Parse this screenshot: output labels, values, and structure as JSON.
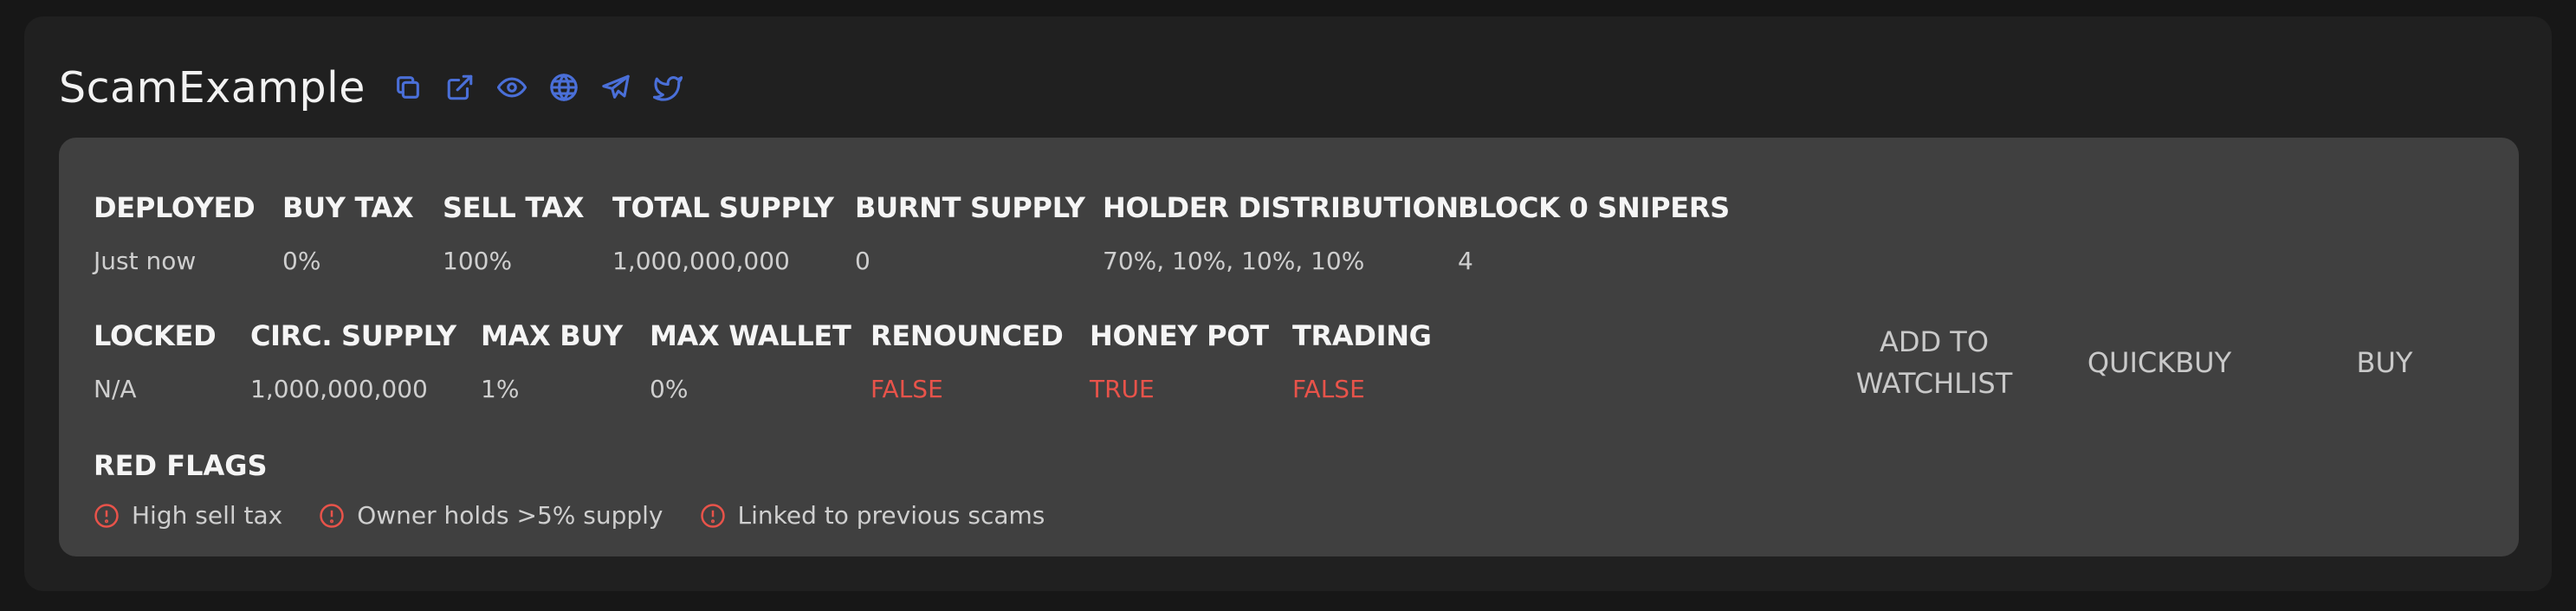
{
  "header": {
    "title": "ScamExample",
    "icons": [
      "copy-icon",
      "external-link-icon",
      "eye-icon",
      "globe-icon",
      "telegram-icon",
      "twitter-icon"
    ]
  },
  "row1": [
    {
      "label": "DEPLOYED",
      "value": "Just now"
    },
    {
      "label": "BUY TAX",
      "value": "0%"
    },
    {
      "label": "SELL TAX",
      "value": "100%"
    },
    {
      "label": "TOTAL SUPPLY",
      "value": "1,000,000,000"
    },
    {
      "label": "BURNT SUPPLY",
      "value": "0"
    },
    {
      "label": "HOLDER DISTRIBUTION",
      "value": "70%, 10%, 10%, 10%"
    },
    {
      "label": "BLOCK 0 SNIPERS",
      "value": "4"
    }
  ],
  "row2": [
    {
      "label": "LOCKED",
      "value": "N/A"
    },
    {
      "label": "CIRC. SUPPLY",
      "value": "1,000,000,000"
    },
    {
      "label": "MAX BUY",
      "value": "1%"
    },
    {
      "label": "MAX WALLET",
      "value": "0%"
    },
    {
      "label": "RENOUNCED",
      "value": "FALSE"
    },
    {
      "label": "HONEY POT",
      "value": "TRUE"
    },
    {
      "label": "TRADING",
      "value": "FALSE"
    }
  ],
  "red_flags": {
    "label": "RED FLAGS",
    "items": [
      "High sell tax",
      "Owner holds >5% supply",
      "Linked to previous scams"
    ]
  },
  "actions": {
    "watchlist_line1": "ADD TO",
    "watchlist_line2": "WATCHLIST",
    "quickbuy": "QUICKBUY",
    "buy": "BUY"
  },
  "colors": {
    "accent_icon": "#4a6fd8",
    "warning": "#e8534a",
    "panel": "#404040",
    "card": "#202020",
    "background": "#171717"
  }
}
